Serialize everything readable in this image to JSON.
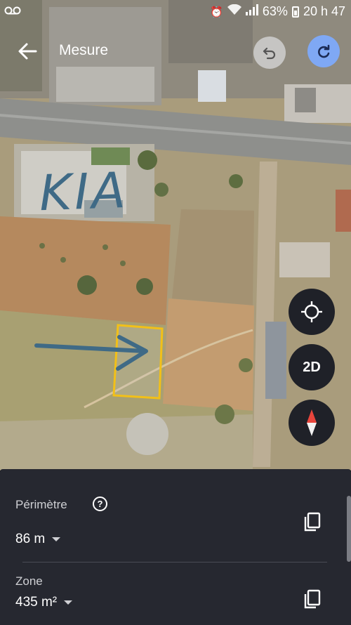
{
  "status_bar": {
    "battery": "63%",
    "time": "20 h 47"
  },
  "app_bar": {
    "title": "Mesure"
  },
  "map": {
    "annotation_text": "KIA"
  },
  "controls": {
    "view_mode_label": "2D"
  },
  "measurements": {
    "perimeter_label": "Périmètre",
    "perimeter_value": "86 m",
    "area_label": "Zone",
    "area_value": "435 m²"
  },
  "colors": {
    "sheet_background": "#262830",
    "accent_redo": "#7fa8f4",
    "measurement_outline": "#f2c018",
    "annotation_ink": "#3f6a86"
  }
}
